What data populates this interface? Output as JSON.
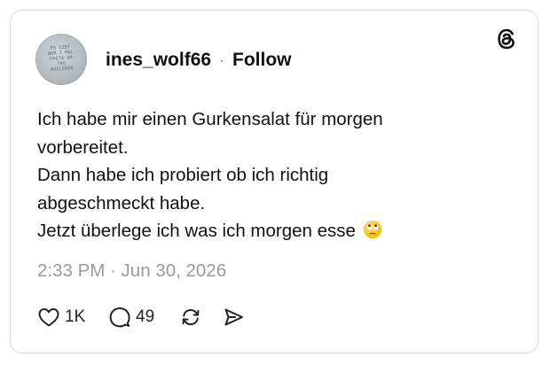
{
  "post": {
    "avatar_text": "ES GIBT\nNUR 1 MAL\nPASTA AM\nTAG\nAUSLEBEN",
    "username": "ines_wolf66",
    "separator": "·",
    "follow_label": "Follow",
    "body_lines": [
      "Ich habe mir einen Gurkensalat für morgen",
      "vorbereitet.",
      "Dann habe ich probiert ob ich richtig",
      "abgeschmeckt habe.",
      "Jetzt überlege ich was ich morgen esse"
    ],
    "emoji": "eye-roll-emoji",
    "timestamp": "2:33 PM · Jun 30, 2026"
  },
  "actions": {
    "likes": "1K",
    "replies": "49",
    "icons": [
      "heart-icon",
      "comment-icon",
      "repost-icon",
      "share-icon"
    ]
  },
  "colors": {
    "text": "#111111",
    "muted": "#9a9a9a",
    "border": "#d9d9d9",
    "emoji_face": "#FFD02E"
  }
}
